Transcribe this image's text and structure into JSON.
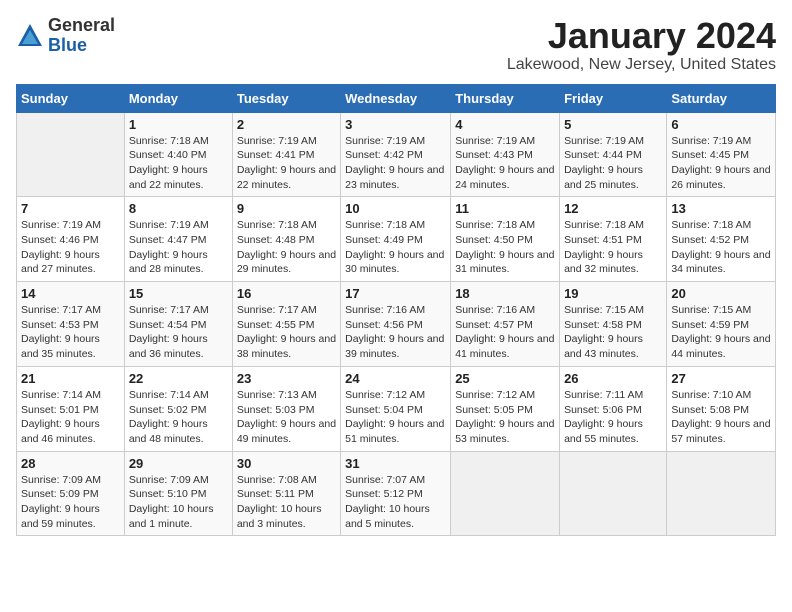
{
  "header": {
    "logo": {
      "general": "General",
      "blue": "Blue"
    },
    "title": "January 2024",
    "subtitle": "Lakewood, New Jersey, United States"
  },
  "weekdays": [
    "Sunday",
    "Monday",
    "Tuesday",
    "Wednesday",
    "Thursday",
    "Friday",
    "Saturday"
  ],
  "weeks": [
    [
      {
        "day": null
      },
      {
        "day": "1",
        "sunrise": "7:18 AM",
        "sunset": "4:40 PM",
        "daylight": "9 hours and 22 minutes."
      },
      {
        "day": "2",
        "sunrise": "7:19 AM",
        "sunset": "4:41 PM",
        "daylight": "9 hours and 22 minutes."
      },
      {
        "day": "3",
        "sunrise": "7:19 AM",
        "sunset": "4:42 PM",
        "daylight": "9 hours and 23 minutes."
      },
      {
        "day": "4",
        "sunrise": "7:19 AM",
        "sunset": "4:43 PM",
        "daylight": "9 hours and 24 minutes."
      },
      {
        "day": "5",
        "sunrise": "7:19 AM",
        "sunset": "4:44 PM",
        "daylight": "9 hours and 25 minutes."
      },
      {
        "day": "6",
        "sunrise": "7:19 AM",
        "sunset": "4:45 PM",
        "daylight": "9 hours and 26 minutes."
      }
    ],
    [
      {
        "day": "7",
        "sunrise": "7:19 AM",
        "sunset": "4:46 PM",
        "daylight": "9 hours and 27 minutes."
      },
      {
        "day": "8",
        "sunrise": "7:19 AM",
        "sunset": "4:47 PM",
        "daylight": "9 hours and 28 minutes."
      },
      {
        "day": "9",
        "sunrise": "7:18 AM",
        "sunset": "4:48 PM",
        "daylight": "9 hours and 29 minutes."
      },
      {
        "day": "10",
        "sunrise": "7:18 AM",
        "sunset": "4:49 PM",
        "daylight": "9 hours and 30 minutes."
      },
      {
        "day": "11",
        "sunrise": "7:18 AM",
        "sunset": "4:50 PM",
        "daylight": "9 hours and 31 minutes."
      },
      {
        "day": "12",
        "sunrise": "7:18 AM",
        "sunset": "4:51 PM",
        "daylight": "9 hours and 32 minutes."
      },
      {
        "day": "13",
        "sunrise": "7:18 AM",
        "sunset": "4:52 PM",
        "daylight": "9 hours and 34 minutes."
      }
    ],
    [
      {
        "day": "14",
        "sunrise": "7:17 AM",
        "sunset": "4:53 PM",
        "daylight": "9 hours and 35 minutes."
      },
      {
        "day": "15",
        "sunrise": "7:17 AM",
        "sunset": "4:54 PM",
        "daylight": "9 hours and 36 minutes."
      },
      {
        "day": "16",
        "sunrise": "7:17 AM",
        "sunset": "4:55 PM",
        "daylight": "9 hours and 38 minutes."
      },
      {
        "day": "17",
        "sunrise": "7:16 AM",
        "sunset": "4:56 PM",
        "daylight": "9 hours and 39 minutes."
      },
      {
        "day": "18",
        "sunrise": "7:16 AM",
        "sunset": "4:57 PM",
        "daylight": "9 hours and 41 minutes."
      },
      {
        "day": "19",
        "sunrise": "7:15 AM",
        "sunset": "4:58 PM",
        "daylight": "9 hours and 43 minutes."
      },
      {
        "day": "20",
        "sunrise": "7:15 AM",
        "sunset": "4:59 PM",
        "daylight": "9 hours and 44 minutes."
      }
    ],
    [
      {
        "day": "21",
        "sunrise": "7:14 AM",
        "sunset": "5:01 PM",
        "daylight": "9 hours and 46 minutes."
      },
      {
        "day": "22",
        "sunrise": "7:14 AM",
        "sunset": "5:02 PM",
        "daylight": "9 hours and 48 minutes."
      },
      {
        "day": "23",
        "sunrise": "7:13 AM",
        "sunset": "5:03 PM",
        "daylight": "9 hours and 49 minutes."
      },
      {
        "day": "24",
        "sunrise": "7:12 AM",
        "sunset": "5:04 PM",
        "daylight": "9 hours and 51 minutes."
      },
      {
        "day": "25",
        "sunrise": "7:12 AM",
        "sunset": "5:05 PM",
        "daylight": "9 hours and 53 minutes."
      },
      {
        "day": "26",
        "sunrise": "7:11 AM",
        "sunset": "5:06 PM",
        "daylight": "9 hours and 55 minutes."
      },
      {
        "day": "27",
        "sunrise": "7:10 AM",
        "sunset": "5:08 PM",
        "daylight": "9 hours and 57 minutes."
      }
    ],
    [
      {
        "day": "28",
        "sunrise": "7:09 AM",
        "sunset": "5:09 PM",
        "daylight": "9 hours and 59 minutes."
      },
      {
        "day": "29",
        "sunrise": "7:09 AM",
        "sunset": "5:10 PM",
        "daylight": "10 hours and 1 minute."
      },
      {
        "day": "30",
        "sunrise": "7:08 AM",
        "sunset": "5:11 PM",
        "daylight": "10 hours and 3 minutes."
      },
      {
        "day": "31",
        "sunrise": "7:07 AM",
        "sunset": "5:12 PM",
        "daylight": "10 hours and 5 minutes."
      },
      {
        "day": null
      },
      {
        "day": null
      },
      {
        "day": null
      }
    ]
  ]
}
